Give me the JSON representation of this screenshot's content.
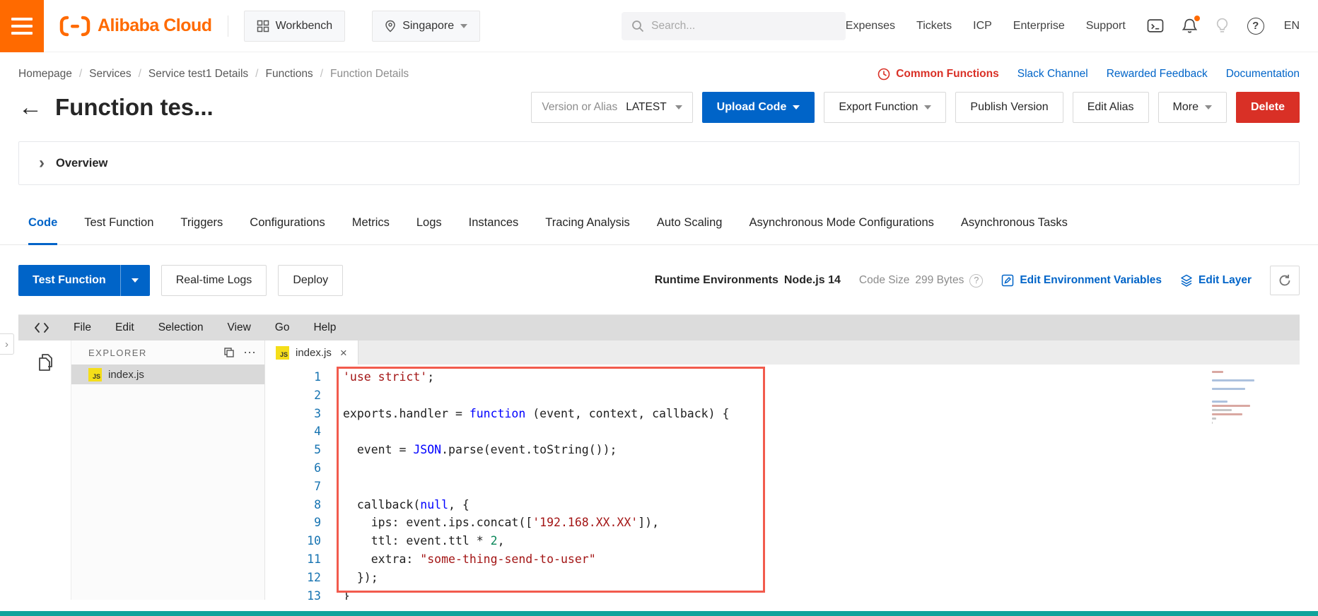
{
  "colors": {
    "brand_orange": "#FF6A00",
    "accent_blue": "#0064C8",
    "danger_red": "#D93026",
    "link_blue": "#0064C8",
    "status_bar_teal": "#10A39B",
    "highlight_border": "#F25B4D",
    "js_icon_yellow": "#F5DE19"
  },
  "icons": {
    "back_arrow": "←",
    "chevron_right": "›",
    "close": "×",
    "ellipsis": "⋯",
    "question": "?",
    "js_badge": "JS"
  },
  "topbar": {
    "logo_text": "Alibaba Cloud",
    "workbench": "Workbench",
    "region": "Singapore",
    "search_placeholder": "Search...",
    "nav": [
      "Expenses",
      "Tickets",
      "ICP",
      "Enterprise",
      "Support"
    ],
    "lang": "EN"
  },
  "breadcrumb": {
    "items": [
      "Homepage",
      "Services",
      "Service test1 Details",
      "Functions",
      "Function Details"
    ],
    "links": [
      "Common Functions",
      "Slack Channel",
      "Rewarded Feedback",
      "Documentation"
    ]
  },
  "header": {
    "title": "Function tes...",
    "version_label": "Version or Alias",
    "version_value": "LATEST",
    "upload_code": "Upload Code",
    "export_function": "Export Function",
    "publish_version": "Publish Version",
    "edit_alias": "Edit Alias",
    "more": "More",
    "delete": "Delete"
  },
  "overview_label": "Overview",
  "tabs": [
    {
      "label": "Code",
      "active": true
    },
    {
      "label": "Test Function",
      "active": false
    },
    {
      "label": "Triggers",
      "active": false
    },
    {
      "label": "Configurations",
      "active": false
    },
    {
      "label": "Metrics",
      "active": false
    },
    {
      "label": "Logs",
      "active": false
    },
    {
      "label": "Instances",
      "active": false
    },
    {
      "label": "Tracing Analysis",
      "active": false
    },
    {
      "label": "Auto Scaling",
      "active": false
    },
    {
      "label": "Asynchronous Mode Configurations",
      "active": false
    },
    {
      "label": "Asynchronous Tasks",
      "active": false
    }
  ],
  "actionbar": {
    "test_function": "Test Function",
    "realtime_logs": "Real-time Logs",
    "deploy": "Deploy",
    "runtime_label": "Runtime Environments",
    "runtime_value": "Node.js 14",
    "code_size_label": "Code Size",
    "code_size_value": "299 Bytes",
    "edit_env": "Edit Environment Variables",
    "edit_layer": "Edit Layer"
  },
  "ide": {
    "menu": [
      "File",
      "Edit",
      "Selection",
      "View",
      "Go",
      "Help"
    ],
    "explorer_title": "EXPLORER",
    "file_name": "index.js",
    "tab_name": "index.js",
    "code": {
      "language": "javascript",
      "lines": [
        {
          "n": 1,
          "seg": [
            [
              "'use strict'",
              "str"
            ],
            [
              ";",
              "pln"
            ]
          ]
        },
        {
          "n": 2,
          "seg": []
        },
        {
          "n": 3,
          "seg": [
            [
              "exports.handler = ",
              "pln"
            ],
            [
              "function",
              "kw"
            ],
            [
              " (event, context, callback) {",
              "pln"
            ]
          ]
        },
        {
          "n": 4,
          "seg": []
        },
        {
          "n": 5,
          "seg": [
            [
              "  event = ",
              "pln"
            ],
            [
              "JSON",
              "kw"
            ],
            [
              ".parse(event.toString());",
              "pln"
            ]
          ]
        },
        {
          "n": 6,
          "seg": []
        },
        {
          "n": 7,
          "seg": []
        },
        {
          "n": 8,
          "seg": [
            [
              "  callback(",
              "pln"
            ],
            [
              "null",
              "kw"
            ],
            [
              ", {",
              "pln"
            ]
          ]
        },
        {
          "n": 9,
          "seg": [
            [
              "    ips: event.ips.concat([",
              "pln"
            ],
            [
              "'192.168.XX.XX'",
              "str"
            ],
            [
              "]),",
              "pln"
            ]
          ]
        },
        {
          "n": 10,
          "seg": [
            [
              "    ttl: event.ttl * ",
              "pln"
            ],
            [
              "2",
              "num"
            ],
            [
              ",",
              "pln"
            ]
          ]
        },
        {
          "n": 11,
          "seg": [
            [
              "    extra: ",
              "pln"
            ],
            [
              "\"some-thing-send-to-user\"",
              "str"
            ]
          ]
        },
        {
          "n": 12,
          "seg": [
            [
              "  });",
              "pln"
            ]
          ]
        },
        {
          "n": 13,
          "seg": [
            [
              "}",
              "pln"
            ]
          ]
        }
      ]
    }
  }
}
